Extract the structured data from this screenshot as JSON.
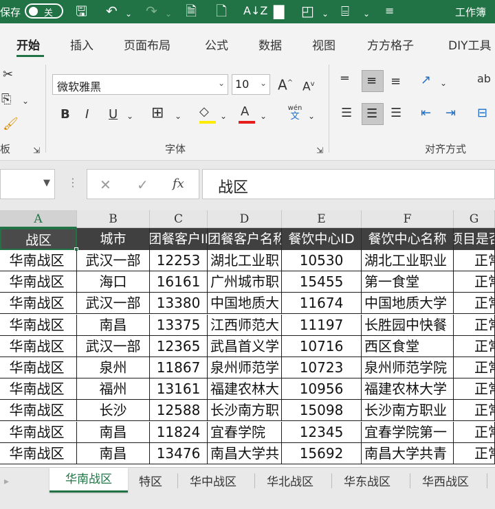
{
  "titlebar": {
    "autosave_label": "保存",
    "autosave_state": "关",
    "doc_title": "工作簿",
    "qa_icons": [
      "save-icon",
      "undo-icon",
      "redo-icon",
      "print-preview-icon",
      "new-file-icon",
      "sort-icon",
      "chart-icon",
      "shapes-icon",
      "textbox-icon",
      "customize-icon"
    ]
  },
  "ribbon_tabs": [
    "开始",
    "插入",
    "页面布局",
    "公式",
    "数据",
    "视图",
    "方方格子",
    "DIY工具"
  ],
  "ribbon": {
    "clipboard_label": "板",
    "font_group_label": "字体",
    "font_name": "微软雅黑",
    "font_size": "10",
    "bold": "B",
    "italic": "I",
    "underline": "U",
    "grow_font": "A",
    "shrink_font": "A",
    "phonetic_top": "wén",
    "phonetic_bottom": "文",
    "align_group_label": "对齐方式",
    "wrap_label": "ab",
    "highlight_color": "#ffeb00",
    "font_color": "#e51c1c"
  },
  "formula_bar": {
    "cancel": "✕",
    "confirm": "✓",
    "fx": "fx",
    "value": "战区"
  },
  "columns": [
    "A",
    "B",
    "C",
    "D",
    "E",
    "F",
    "G"
  ],
  "header_row": [
    "战区",
    "城市",
    "团餐客户ID",
    "团餐客户名称",
    "餐饮中心ID",
    "餐饮中心名称",
    "项目是否"
  ],
  "rows": [
    [
      "华南战区",
      "武汉一部",
      "12253",
      "湖北工业职",
      "10530",
      "湖北工业职业",
      "正常"
    ],
    [
      "华南战区",
      "海口",
      "16161",
      "广州城市职",
      "15455",
      "第一食堂",
      "正常"
    ],
    [
      "华南战区",
      "武汉一部",
      "13380",
      "中国地质大",
      "11674",
      "中国地质大学",
      "正常"
    ],
    [
      "华南战区",
      "南昌",
      "13375",
      "江西师范大",
      "11197",
      "长胜园中快餐",
      "正常"
    ],
    [
      "华南战区",
      "武汉一部",
      "12365",
      "武昌首义学",
      "10716",
      "西区食堂",
      "正常"
    ],
    [
      "华南战区",
      "泉州",
      "11867",
      "泉州师范学",
      "10723",
      "泉州师范学院",
      "正常"
    ],
    [
      "华南战区",
      "福州",
      "13161",
      "福建农林大",
      "10956",
      "福建农林大学",
      "正常"
    ],
    [
      "华南战区",
      "长沙",
      "12588",
      "长沙南方职",
      "15098",
      "长沙南方职业",
      "正常"
    ],
    [
      "华南战区",
      "南昌",
      "11824",
      "宜春学院",
      "12345",
      "宜春学院第一",
      "正常"
    ],
    [
      "华南战区",
      "南昌",
      "13476",
      "南昌大学共",
      "15692",
      "南昌大学共青",
      "正常"
    ]
  ],
  "sheet_tabs": [
    "华南战区",
    "特区",
    "华中战区",
    "华北战区",
    "华东战区",
    "华西战区"
  ],
  "accent_color": "#217346"
}
